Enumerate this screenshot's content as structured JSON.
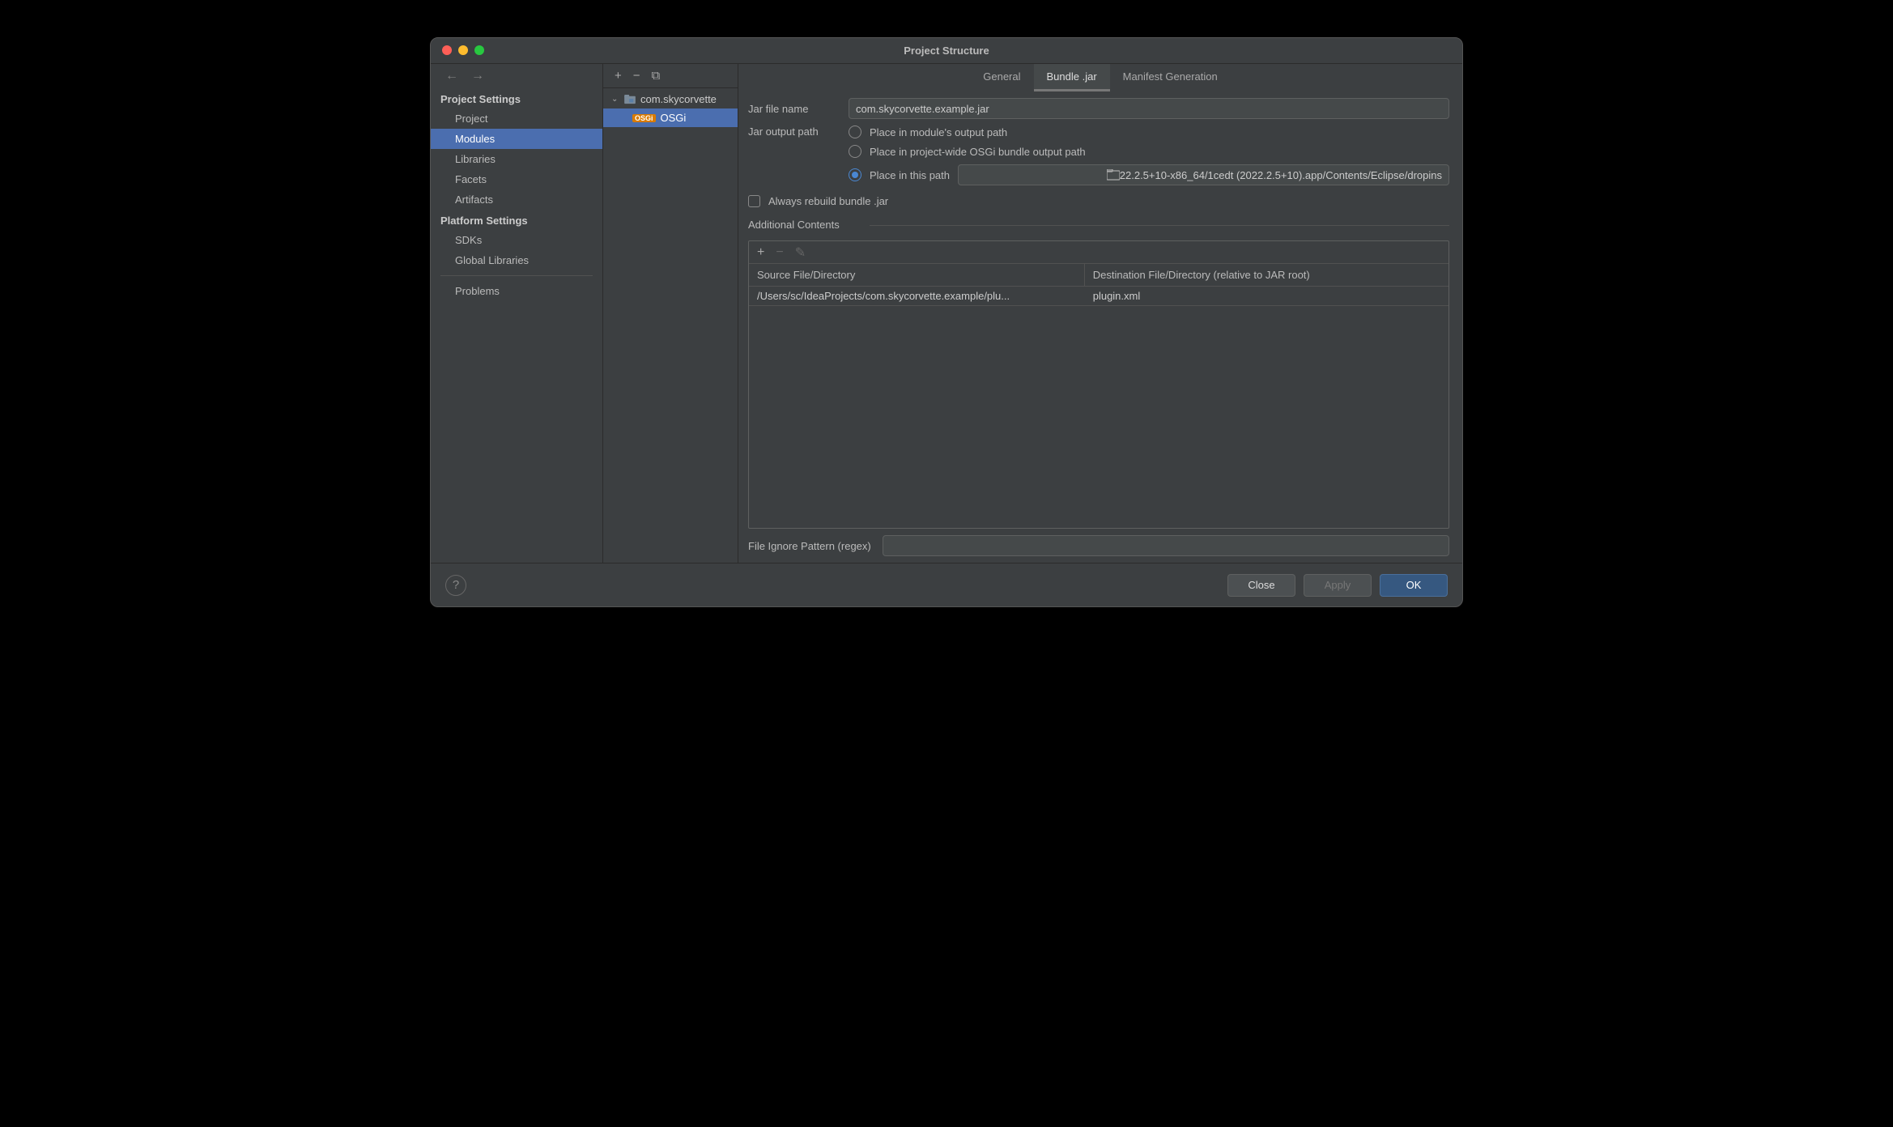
{
  "window": {
    "title": "Project Structure"
  },
  "sidebar": {
    "sections": {
      "project_settings": {
        "label": "Project Settings",
        "items": [
          "Project",
          "Modules",
          "Libraries",
          "Facets",
          "Artifacts"
        ],
        "selected": 1
      },
      "platform_settings": {
        "label": "Platform Settings",
        "items": [
          "SDKs",
          "Global Libraries"
        ]
      },
      "problems": "Problems"
    }
  },
  "modules_tree": {
    "root": {
      "name": "com.skycorvette",
      "expanded": true
    },
    "child": {
      "name": "OSGi",
      "badge": "OSGi",
      "selected": true
    }
  },
  "tabs": {
    "items": [
      "General",
      "Bundle .jar",
      "Manifest Generation"
    ],
    "active": 1
  },
  "form": {
    "jar_file_name_label": "Jar file name",
    "jar_file_name_value": "com.skycorvette.example.jar",
    "jar_output_label": "Jar output path",
    "radios": {
      "module": "Place in module's output path",
      "project": "Place in project-wide OSGi bundle output path",
      "this": "Place in this path",
      "selected": "this",
      "this_path": "22.2.5+10-x86_64/1cedt (2022.2.5+10).app/Contents/Eclipse/dropins"
    },
    "always_rebuild": "Always rebuild bundle .jar",
    "additional_contents_label": "Additional Contents",
    "table": {
      "headers": [
        "Source File/Directory",
        "Destination File/Directory (relative to JAR root)"
      ],
      "rows": [
        {
          "src": "/Users/sc/IdeaProjects/com.skycorvette.example/plu...",
          "dst": "plugin.xml"
        }
      ]
    },
    "ignore_pattern_label": "File Ignore Pattern (regex)",
    "ignore_pattern_value": ""
  },
  "footer": {
    "close": "Close",
    "apply": "Apply",
    "ok": "OK"
  }
}
